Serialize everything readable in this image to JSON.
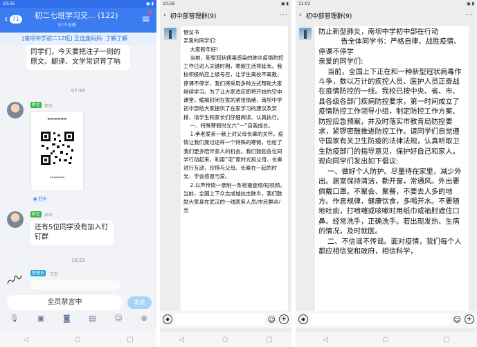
{
  "phone1": {
    "status_time": "10:56",
    "status_right": "▣ ▮",
    "back_badge": "71",
    "title": "初二七班学习交...  (122)",
    "subtitle": "97人在线",
    "notice": "[南坝中学初二12班] 王佳鑫妈妈: 了解了解",
    "partial_msg": "同学们，今天要把注子一则的原文、翻译、文学常识背了呐",
    "time1": "07:54",
    "sender1_role": "群主",
    "sender1_name": "李华",
    "reaction_label": "打卡",
    "sender2_role": "群主",
    "sender2_name": "李华",
    "msg2": "还有5位同学没有加入钉钉群",
    "time2": "10:53",
    "sender3_role": "管理员",
    "sender3_name": "王宏",
    "mute_text": "全员禁言中",
    "send_label": "发送",
    "tool_icons": [
      "mic-icon",
      "image-icon",
      "camera-icon",
      "gift-icon",
      "emoji-icon",
      "plus-icon"
    ]
  },
  "phone2": {
    "status_time": "10:58",
    "status_right": "▣ ▮",
    "title": "初中部管理群(9)",
    "doc": "倡议书\n亲爱的同学们:\n    大家新年好!\n    当前，新型冠状病毒感染的肺炎疫情防控工作已进入关键时期，寒假生活将延长。我校积极响应上级号召，让学生离校不离教，停课不停学，我们将采用多种方式帮助大家继续学习。为了让大家适应即将开始的空中课堂，缓解封闭在家的紧张情绪，南坝中学初中部给大家提供了在家学习的建议及安排，请学生和家长们仔细阅读、认真执行。\n    一、特殊寒假时光六“一”自我成长。\n    1.孝老爱亲一献上对父母长辈的关怀。疫情让我们度过这样一个特殊的寒假，也给了我们更多陪伴家人的机会。我们鼓励各位同学行动起来，利用“宅”家时光和父母、长辈进行互动，珍惜与父母、长辈在一起的时光，学会感恩与爱。\n    2.以声传情一录制一条祝福音频/短视频。当前，全国上下众志成城抗击肺炎，我们鼓励大家身在武汉的一线医务人员/市民群众/志"
  },
  "phone3": {
    "status_time": "11:03",
    "status_right": "▣ ▮",
    "title": "初中部管理群(9)",
    "doc": "防止新型肺炎，南坝中学初中部在行动\n          告全体同学书：严格自律、战胜疫情、停课不停学\n亲爱的同学们:\n    当前，全国上下正在和一种新型冠状病毒作斗争，数以万计的疾控人员、医护人员正奋战在疫情防控的一线。我校已按中央、省、市、县各级各部门疾病防控要求，第一时间成立了疫情防控工作领导小组，制定防控工作方案、防控应急预案，并及时落实市教育局防控要求，紧锣密鼓推进防控工作。请同学们自觉遵守国家有关卫生防疫的法律法规，认真听取卫生防疫部门的指导意见，保护好自己和家人。现向同学们发出如下倡议:\n    一、做好个人防护。尽量待在家里，减少外出。居室保持清洁，勤开窗，常通风。外出要佩戴口罩。不聚会、聚餐，不要去人多的地方。作息规律，健康饮食，多喝开水。不要随地吐痰，打喷嚏或咳嗽时用纸巾或袖肘遮住口鼻。经常洗手，正确洗手。若出现发热、生病的情况，及时就医。\n    二、不信谣不传谣。面对疫情，我们每个人都应相信党和政府，相信科学，"
  },
  "colors": {
    "qq_blue": "#3b7cf0",
    "owner_tag": "#35b54b",
    "admin_tag": "#2aa5d7"
  }
}
